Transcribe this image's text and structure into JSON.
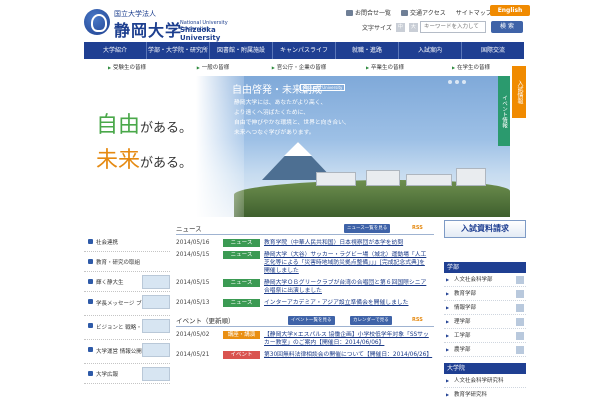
{
  "header": {
    "corp_label": "国立大学法人",
    "university_name": "静岡大学",
    "english_line1": "National University Corporation",
    "english_line2": "Shizuoka University",
    "links": [
      "お問合せ一覧",
      "交通アクセス",
      "サイトマップ"
    ],
    "english_button": "English",
    "font_size_label": "文字サイズ",
    "font_sizes": [
      "中",
      "大"
    ],
    "search_placeholder": "キーワードを入力して",
    "search_button": "検 索"
  },
  "global_nav": [
    "大学紹介",
    "学部・大学院・研究所",
    "図書館・附属施設",
    "キャンパスライフ",
    "就職・進路",
    "入試案内",
    "国際交流"
  ],
  "audience_nav": [
    "受験生の皆様",
    "一般の皆様",
    "官公庁・企業の皆様",
    "卒業生の皆様",
    "在学生の皆様"
  ],
  "hero": {
    "line1_big": "自由",
    "line1_small": "がある。",
    "line2_big": "未来",
    "line2_small": "がある。",
    "heading": "自由啓発・未来創成",
    "heading_tag": "Shizuoka University",
    "text_lines": [
      "静岡大学には、あなたがより高く、",
      "より遠くへ羽ばたくために、",
      "自由で伸びやかな環境と、世界と向き合い、",
      "未来へつなぐ学びがあります。"
    ],
    "caption": "",
    "side_tab_event": "イベント情報",
    "side_tab_exam": "入試情報"
  },
  "left_menu": [
    "社会連携",
    "教育・研究の取組",
    "輝く静大生",
    "学長メッセージ ブログ",
    "ビジョンと 戦略・ポリシー",
    "大学運営 情報公開",
    "大学広報"
  ],
  "news": {
    "title": "ニュース",
    "list_button": "ニュース一覧を見る",
    "rss": "RSS",
    "items": [
      {
        "date": "2014/05/16",
        "badge": "ニュース",
        "text": "教育学院（中華人民共和国）日本視察団が本学を訪問"
      },
      {
        "date": "2014/05/15",
        "badge": "ニュース",
        "text": "静岡大学（大谷）サッカー・ラグビー場（城北）運動場「人工芝化等による「災害時地域防災拠点整備」」」[完成記念式典]を開催しました"
      },
      {
        "date": "2014/05/15",
        "badge": "ニュース",
        "text": "静岡大学ＯＢグリークラブが台湾の合唱団と第６回国際シニア合唱祭に出演しました"
      },
      {
        "date": "2014/05/13",
        "badge": "ニュース",
        "text": "インターアカデミア・アジア設立準備会を開催しました"
      }
    ]
  },
  "events": {
    "title": "イベント（更新順）",
    "list_button": "イベント一覧を見る",
    "calendar_button": "カレンダーで見る",
    "rss": "RSS",
    "items": [
      {
        "date": "2014/05/02",
        "badge": "講座・講演",
        "text": "【静岡大学×エスパルス 協働企画】小学校低学年対象「SSサッカー教室」のご案内【開催日：2014/06/06】"
      },
      {
        "date": "2014/05/21",
        "badge": "イベント",
        "text": "第30回無料法律相談会の開催について【開催日：2014/06/26】"
      }
    ]
  },
  "right_col": {
    "request_button": "入試資料請求",
    "faculty_head": "学部",
    "faculties": [
      "人文社会科学部",
      "教育学部",
      "情報学部",
      "理学部",
      "工学部",
      "農学部"
    ],
    "grad_head": "大学院",
    "grad_items": [
      "人文社会科学研究科",
      "教育学研究科"
    ]
  },
  "colors": {
    "nav_blue": "#1f3f92",
    "accent_orange": "#f08a00",
    "news_green": "#3b9a53",
    "event_red": "#d9534f"
  }
}
